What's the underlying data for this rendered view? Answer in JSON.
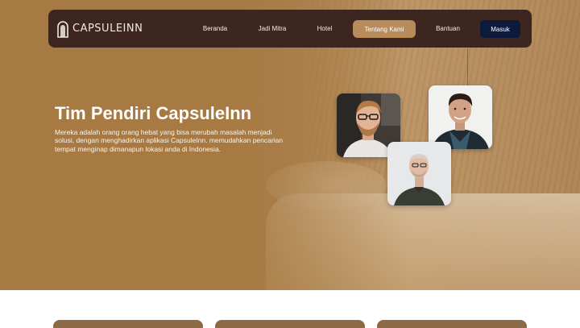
{
  "brand": {
    "name": "CAPSULEINN"
  },
  "nav": {
    "items": [
      "Beranda",
      "Jadi Mitra",
      "Hotel",
      "Tentang Kami",
      "Bantuan"
    ],
    "active": "Tentang Kami",
    "login": "Masuk"
  },
  "hero": {
    "title": "Tim Pendiri CapsuleInn",
    "description": "Mereka adalah orang orang hebat yang bisa merubah masalah menjadi solusi, dengan menghadirkan aplikasi CapsuleInn. memudahkan pencarian tempat menginap dimanapun lokasi anda di Indonesia."
  },
  "colors": {
    "navbar": "#3d2620",
    "active_tab": "#b78b5a",
    "login_button": "#0e1a3c",
    "hero_background": "#a77a44",
    "card": "#8b6a45"
  },
  "founders": [
    {
      "icon": "founder-photo-1"
    },
    {
      "icon": "founder-photo-2"
    },
    {
      "icon": "founder-photo-3"
    }
  ]
}
